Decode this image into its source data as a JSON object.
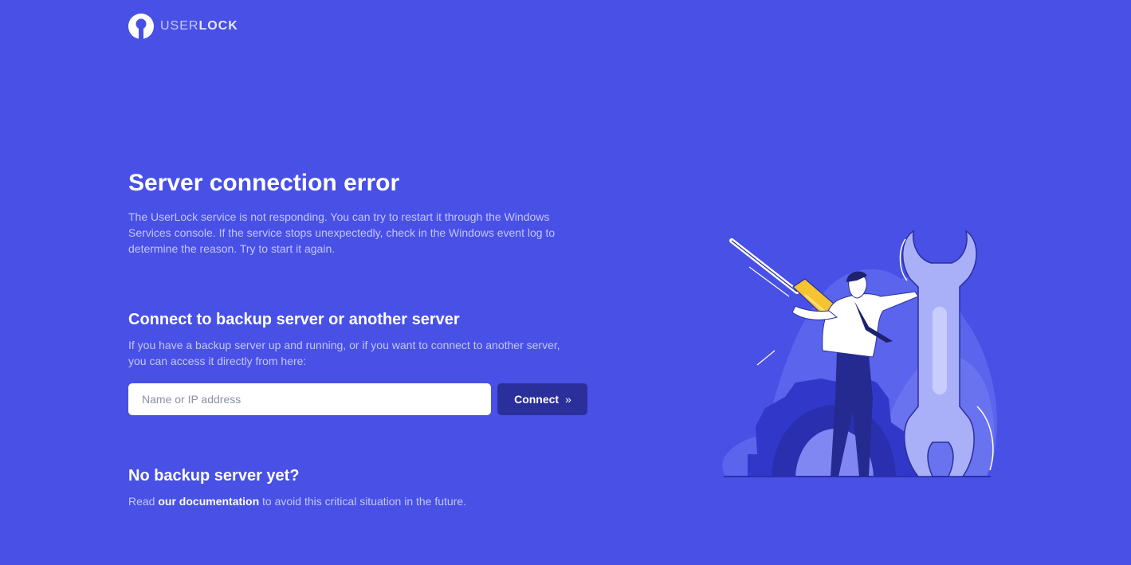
{
  "brand": {
    "name_light": "USER",
    "name_bold": "LOCK",
    "logo_icon": "keyhole-icon"
  },
  "error": {
    "title": "Server connection error",
    "description": "The UserLock service is not responding. You can try to restart it through the Windows Services console. If the service stops unexpectedly, check in the Windows event log to determine the reason. Try to start it again."
  },
  "connect": {
    "title": "Connect to backup server or another server",
    "description": "If you have a backup server up and running, or if you want to connect to another server, you can access it directly from here:",
    "input_placeholder": "Name or IP address",
    "input_value": "",
    "button_label": "Connect",
    "button_icon": "double-chevron-right-icon"
  },
  "no_backup": {
    "title": "No backup server yet?",
    "text_before": "Read ",
    "link_text": "our documentation",
    "text_after": " to avoid this critical situation in the future."
  },
  "colors": {
    "background": "#4850e6",
    "button": "#2a2f9c",
    "muted_text": "#c3c7f7"
  }
}
